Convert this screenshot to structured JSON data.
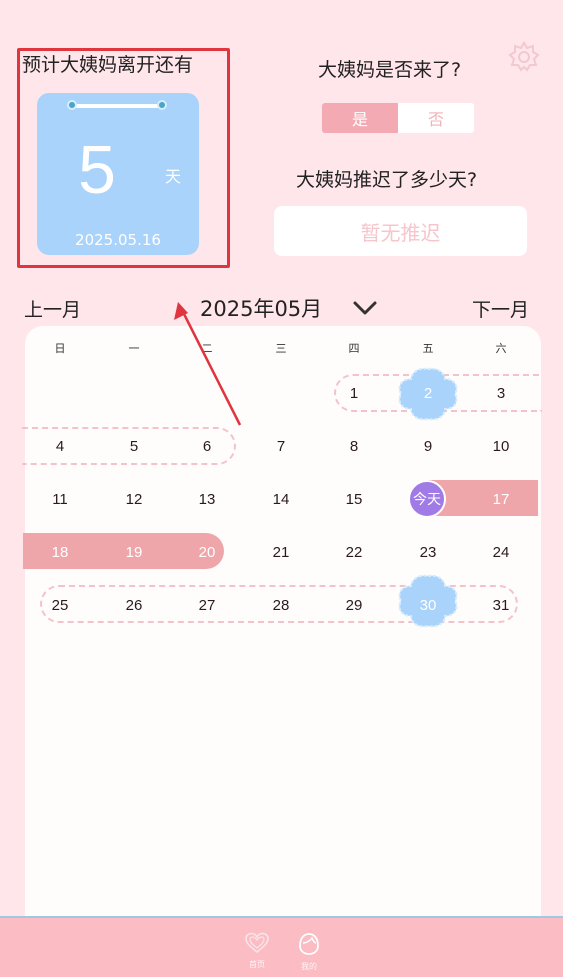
{
  "left_card": {
    "title": "预计大姨妈离开还有",
    "days_number": "5",
    "days_unit": "天",
    "end_date": "2025.05.16"
  },
  "question_came": "大姨妈是否来了?",
  "toggle": {
    "yes": "是",
    "no": "否",
    "selected": "yes"
  },
  "question_delay": "大姨妈推迟了多少天?",
  "delay_button": "暂无推迟",
  "month_nav": {
    "prev": "上一月",
    "current": "2025年05月",
    "next": "下一月"
  },
  "weekdays": [
    "日",
    "一",
    "二",
    "三",
    "四",
    "五",
    "六"
  ],
  "weeks": [
    [
      "",
      "",
      "",
      "",
      "1",
      "2",
      "3"
    ],
    [
      "4",
      "5",
      "6",
      "7",
      "8",
      "9",
      "10"
    ],
    [
      "11",
      "12",
      "13",
      "14",
      "15",
      "今天",
      "17"
    ],
    [
      "18",
      "19",
      "20",
      "21",
      "22",
      "23",
      "24"
    ],
    [
      "25",
      "26",
      "27",
      "28",
      "29",
      "30",
      "31"
    ]
  ],
  "bottom_tabs": [
    {
      "label": "首页",
      "icon": "heart-icon"
    },
    {
      "label": "我的",
      "icon": "profile-icon"
    }
  ],
  "colors": {
    "background": "#ffe6ea",
    "card_blue": "#a9d3fb",
    "period_band": "#efa6ab",
    "today": "#a07be6",
    "highlight": "#e0353f"
  }
}
